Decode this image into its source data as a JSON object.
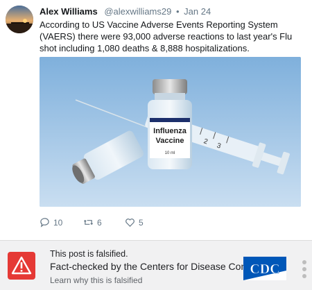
{
  "tweet": {
    "author_name": "Alex Williams",
    "handle": "@alexwilliams29",
    "separator": "•",
    "date": "Jan 24",
    "text": "According to US Vaccine Adverse Events Reporting System (VAERS) there were 93,000 adverse reactions to last year's Flu shot including 1,080 deaths & 8,888 hospitalizations.",
    "image": {
      "label_line1": "Influenza",
      "label_line2": "Vaccine",
      "volume": "10 ml",
      "syringe_marks": [
        "2",
        "3"
      ]
    },
    "actions": {
      "replies": "10",
      "retweets": "6",
      "likes": "5"
    }
  },
  "fact_check": {
    "title": "This post is falsified.",
    "source": "Fact-checked by the Centers for Disease Control",
    "link": "Learn why this is falsified",
    "logo_text": "CDC",
    "accent_color": "#e53935",
    "logo_color": "#0057b8"
  }
}
